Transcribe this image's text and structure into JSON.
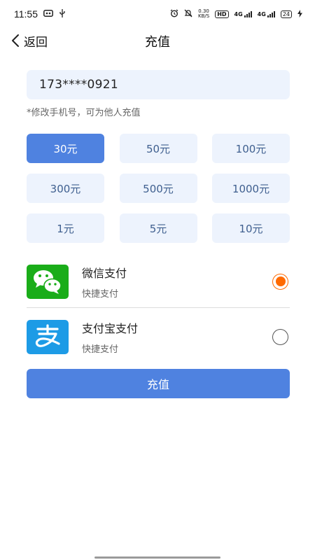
{
  "status_bar": {
    "time": "11:55",
    "icons": [
      "screen-icon",
      "usb-icon",
      "alarm-icon",
      "mute-icon",
      "hd-icon",
      "signal-icon",
      "battery-icon",
      "charging-icon"
    ],
    "speed_value": "0.30",
    "speed_unit": "KB/S",
    "hd_label": "HD",
    "network_1": "4G",
    "network_2": "4G",
    "battery": "24"
  },
  "nav": {
    "back_label": "返回",
    "title": "充值"
  },
  "phone": {
    "value": "173****0921",
    "hint": "*修改手机号，可为他人充值"
  },
  "amounts": [
    "30元",
    "50元",
    "100元",
    "300元",
    "500元",
    "1000元",
    "1元",
    "5元",
    "10元"
  ],
  "selected_amount": "30元",
  "payment": {
    "wechat": {
      "name": "微信支付",
      "sub": "快捷支付",
      "selected": true
    },
    "alipay": {
      "name": "支付宝支付",
      "sub": "快捷支付",
      "selected": false
    }
  },
  "submit_label": "充值",
  "colors": {
    "accent": "#4f82e0",
    "field_bg": "#edf3fd",
    "radio_selected": "#ff6a00",
    "wechat_green": "#1aad19",
    "alipay_blue": "#1d9be6"
  }
}
